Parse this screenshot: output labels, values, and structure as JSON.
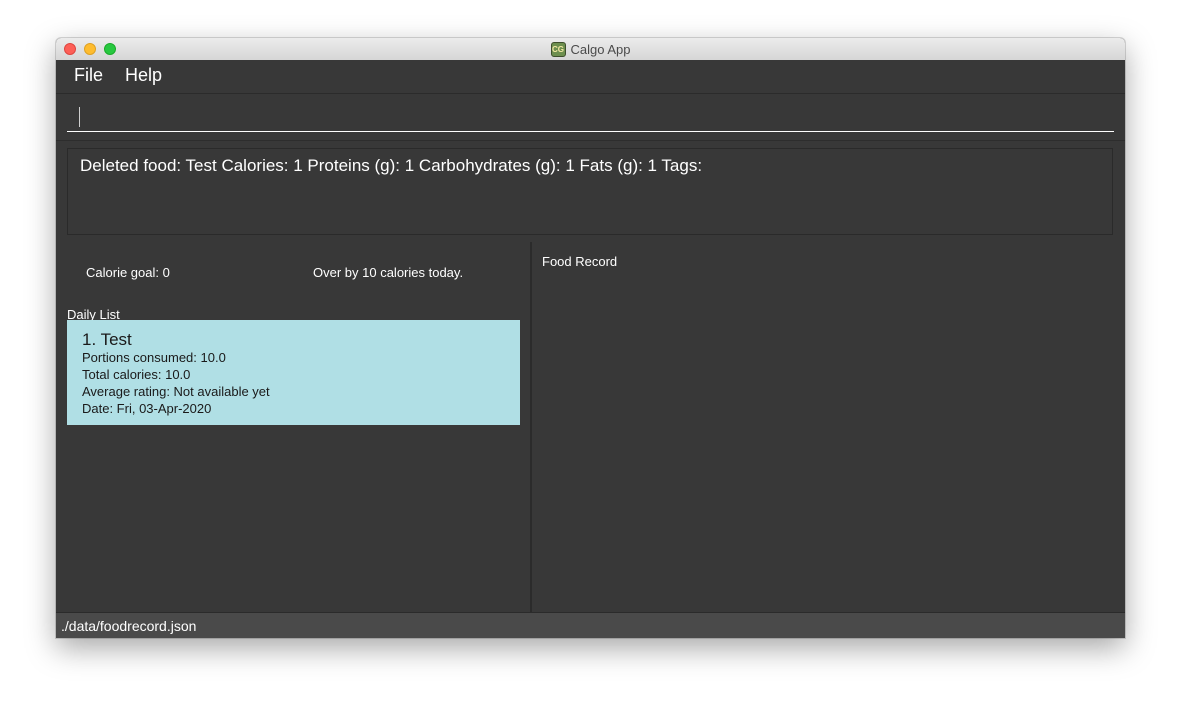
{
  "window": {
    "title": "Calgo App",
    "app_icon_text": "CG"
  },
  "menu": {
    "file": "File",
    "help": "Help"
  },
  "command": {
    "value": "",
    "placeholder": ""
  },
  "result": {
    "message": "Deleted food: Test Calories: 1 Proteins (g): 1 Carbohydrates (g): 1 Fats (g): 1 Tags:"
  },
  "left_panel": {
    "calorie_goal": "Calorie goal: 0",
    "over_status": "Over by 10 calories today.",
    "daily_list_title": "Daily List",
    "items": [
      {
        "name": "1.  Test",
        "portions": "Portions consumed: 10.0",
        "calories": "Total calories: 10.0",
        "rating": "Average rating: Not available yet",
        "date": "Date: Fri, 03-Apr-2020"
      }
    ]
  },
  "right_panel": {
    "title": "Food Record"
  },
  "status_bar": {
    "path": "./data/foodrecord.json"
  },
  "colors": {
    "card_bg": "#b0dfe5",
    "window_bg": "#383838",
    "status_bg": "#4a4a4a"
  }
}
